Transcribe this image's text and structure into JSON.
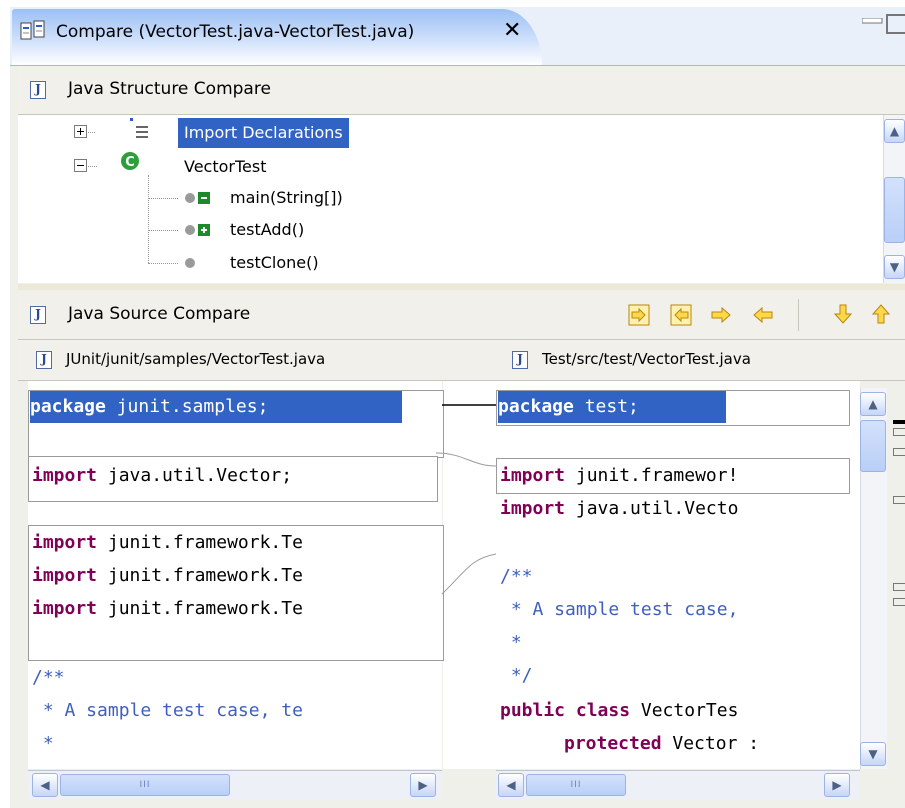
{
  "tab": {
    "title": "Compare (VectorTest.java-VectorTest.java)",
    "close": "✕"
  },
  "structure_pane": {
    "title": "Java Structure Compare",
    "tree": [
      {
        "label": "Import Declarations",
        "selected": true,
        "expander": "+",
        "icon": "imports-icon"
      },
      {
        "label": "VectorTest",
        "expander": "−",
        "icon": "class-icon"
      },
      {
        "label": "main(String[])",
        "icon": "method-removed-icon"
      },
      {
        "label": "testAdd()",
        "icon": "method-added-icon"
      },
      {
        "label": "testClone()",
        "icon": "method-icon"
      }
    ]
  },
  "source_pane": {
    "title": "Java Source Compare",
    "toolbar": [
      "copy-all-left-to-right-icon",
      "copy-all-right-to-left-icon",
      "copy-current-left-to-right-icon",
      "copy-current-right-to-left-icon",
      "next-difference-icon",
      "previous-difference-icon"
    ],
    "left": {
      "path": "JUnit/junit/samples/VectorTest.java",
      "lines": {
        "l1": {
          "kw": "package",
          "rest": " junit.samples;"
        },
        "l2": {
          "kw": "import",
          "rest": " java.util.Vector;"
        },
        "l3": {
          "kw": "import",
          "rest": " junit.framework.Te"
        },
        "l4": {
          "kw": "import",
          "rest": " junit.framework.Te"
        },
        "l5": {
          "kw": "import",
          "rest": " junit.framework.Te"
        },
        "c1": "/**",
        "c2": " * A sample test case, te",
        "c3": " *"
      }
    },
    "right": {
      "path": "Test/src/test/VectorTest.java",
      "lines": {
        "r1": {
          "kw": "package",
          "rest": " test;"
        },
        "r2": {
          "kw": "import",
          "rest": " junit.framewor!"
        },
        "r3": {
          "kw": "import",
          "rest": " java.util.Vecto"
        },
        "c1": "/**",
        "c2": " * A sample test case,",
        "c3": " *",
        "c4": " */",
        "r8": {
          "kw": "public class",
          "rest": " VectorTes"
        },
        "r9": {
          "kw": "protected",
          "rest": " Vector :"
        }
      }
    },
    "scrollbar_grip": "III"
  },
  "colors": {
    "selection": "#3163c5",
    "keyword": "#7f0055",
    "comment": "#3f5fbf",
    "tab": "#9cc0f4"
  }
}
